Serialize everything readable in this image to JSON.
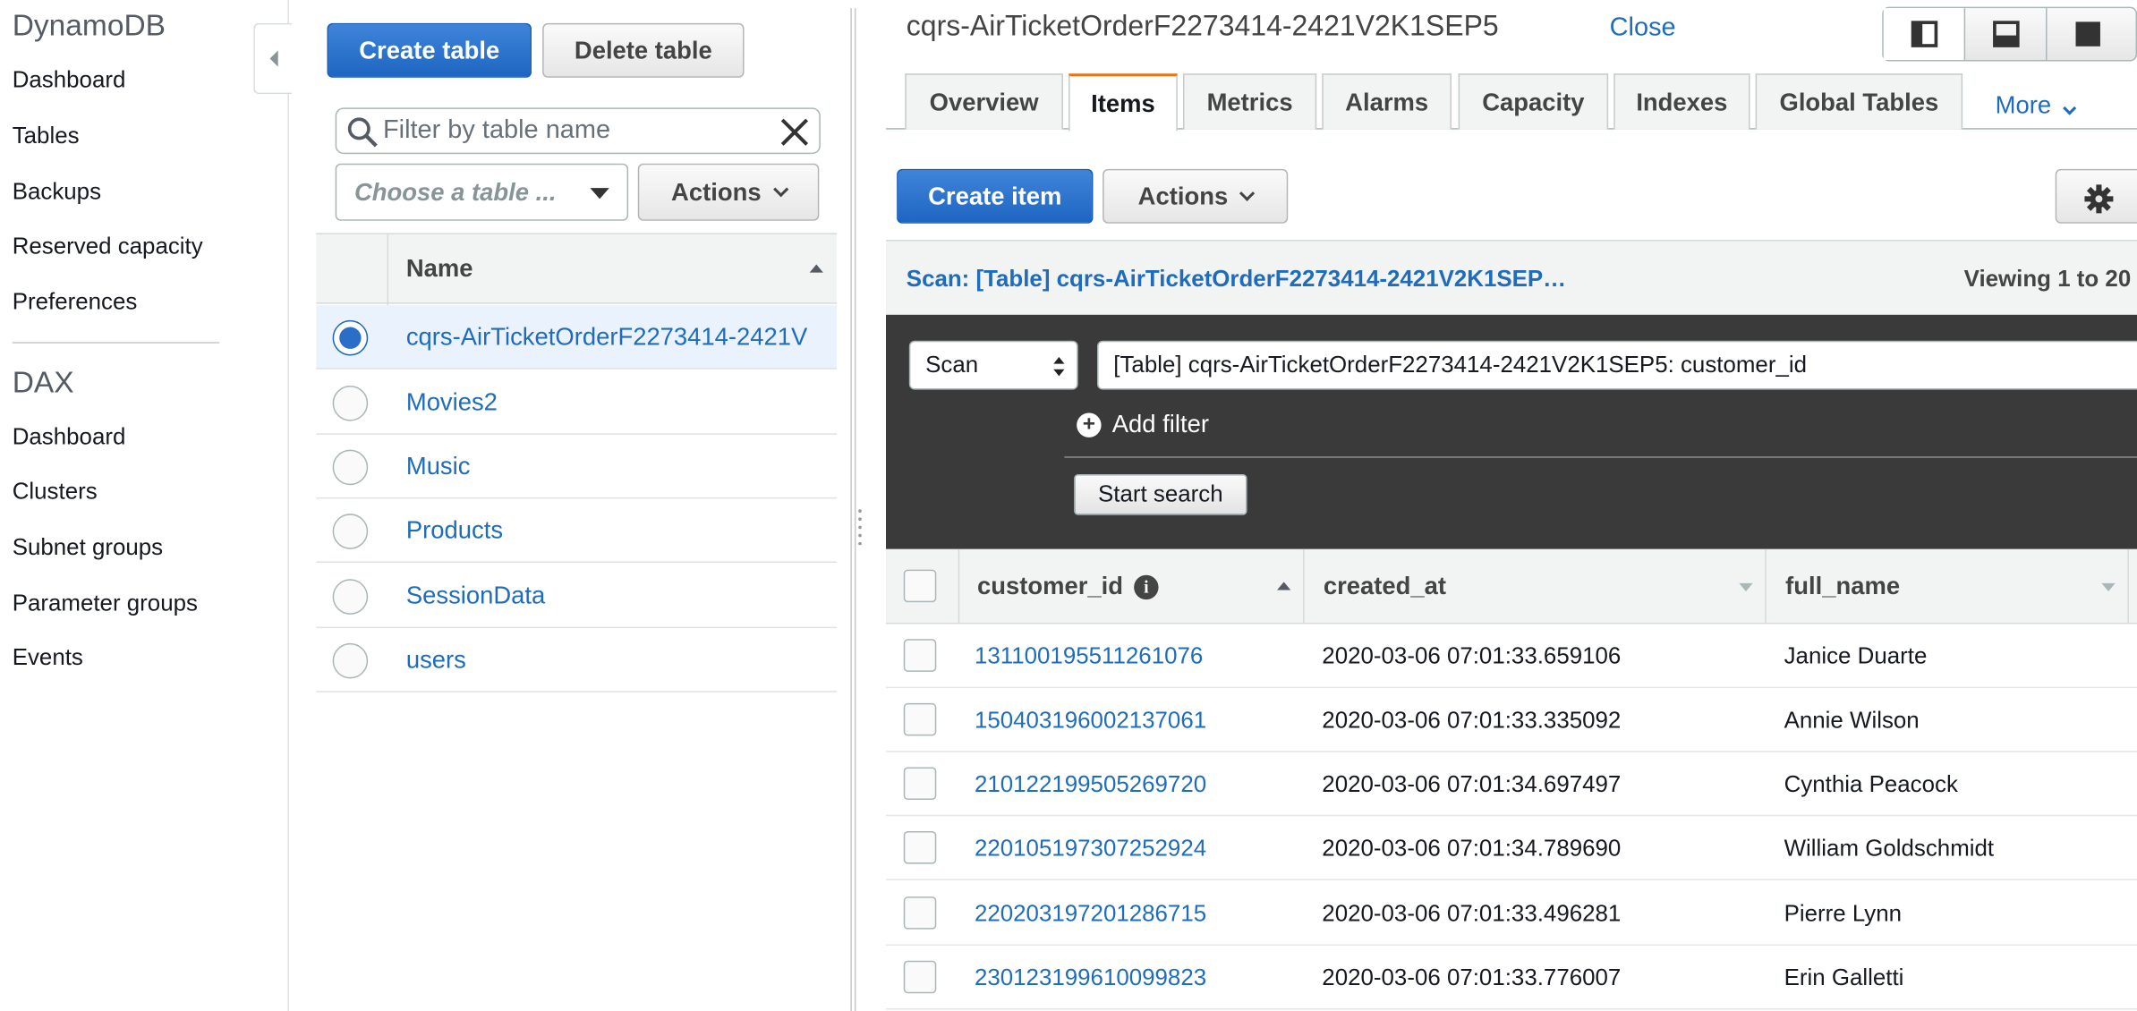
{
  "nav": {
    "title": "DynamoDB",
    "items": [
      "Dashboard",
      "Tables",
      "Backups",
      "Reserved capacity",
      "Preferences"
    ],
    "dax_title": "DAX",
    "dax_items": [
      "Dashboard",
      "Clusters",
      "Subnet groups",
      "Parameter groups",
      "Events"
    ]
  },
  "tables_panel": {
    "create_label": "Create table",
    "delete_label": "Delete table",
    "filter_placeholder": "Filter by table name",
    "choose_label": "Choose a table ...",
    "actions_label": "Actions",
    "name_header": "Name",
    "rows": [
      {
        "name": "cqrs-AirTicketOrderF2273414-2421V",
        "selected": true
      },
      {
        "name": "Movies2",
        "selected": false
      },
      {
        "name": "Music",
        "selected": false
      },
      {
        "name": "Products",
        "selected": false
      },
      {
        "name": "SessionData",
        "selected": false
      },
      {
        "name": "users",
        "selected": false
      }
    ]
  },
  "detail": {
    "title": "cqrs-AirTicketOrderF2273414-2421V2K1SEP5",
    "close_label": "Close",
    "tabs": [
      "Overview",
      "Items",
      "Metrics",
      "Alarms",
      "Capacity",
      "Indexes",
      "Global Tables"
    ],
    "active_tab": "Items",
    "more_label": "More",
    "create_item_label": "Create item",
    "actions_label": "Actions",
    "scan_title": "Scan: [Table] cqrs-AirTicketOrderF2273414-2421V2K1SEP…",
    "viewing_label": "Viewing 1 to 20",
    "scan_mode": "Scan",
    "scan_target": "[Table] cqrs-AirTicketOrderF2273414-2421V2K1SEP5: customer_id",
    "add_filter_label": "Add filter",
    "start_search_label": "Start search",
    "columns": [
      "customer_id",
      "created_at",
      "full_name"
    ],
    "rows": [
      {
        "customer_id": "131100195511261076",
        "created_at": "2020-03-06 07:01:33.659106",
        "full_name": "Janice Duarte"
      },
      {
        "customer_id": "150403196002137061",
        "created_at": "2020-03-06 07:01:33.335092",
        "full_name": "Annie Wilson"
      },
      {
        "customer_id": "210122199505269720",
        "created_at": "2020-03-06 07:01:34.697497",
        "full_name": "Cynthia Peacock"
      },
      {
        "customer_id": "220105197307252924",
        "created_at": "2020-03-06 07:01:34.789690",
        "full_name": "William Goldschmidt"
      },
      {
        "customer_id": "220203197201286715",
        "created_at": "2020-03-06 07:01:33.496281",
        "full_name": "Pierre Lynn"
      },
      {
        "customer_id": "230123199610099823",
        "created_at": "2020-03-06 07:01:33.776007",
        "full_name": "Erin Galletti"
      }
    ]
  },
  "colors": {
    "link": "#1f6cbc",
    "primary": "#2a6ec7",
    "tab_accent": "#ec7211",
    "dark_panel": "#3a3a3a"
  }
}
